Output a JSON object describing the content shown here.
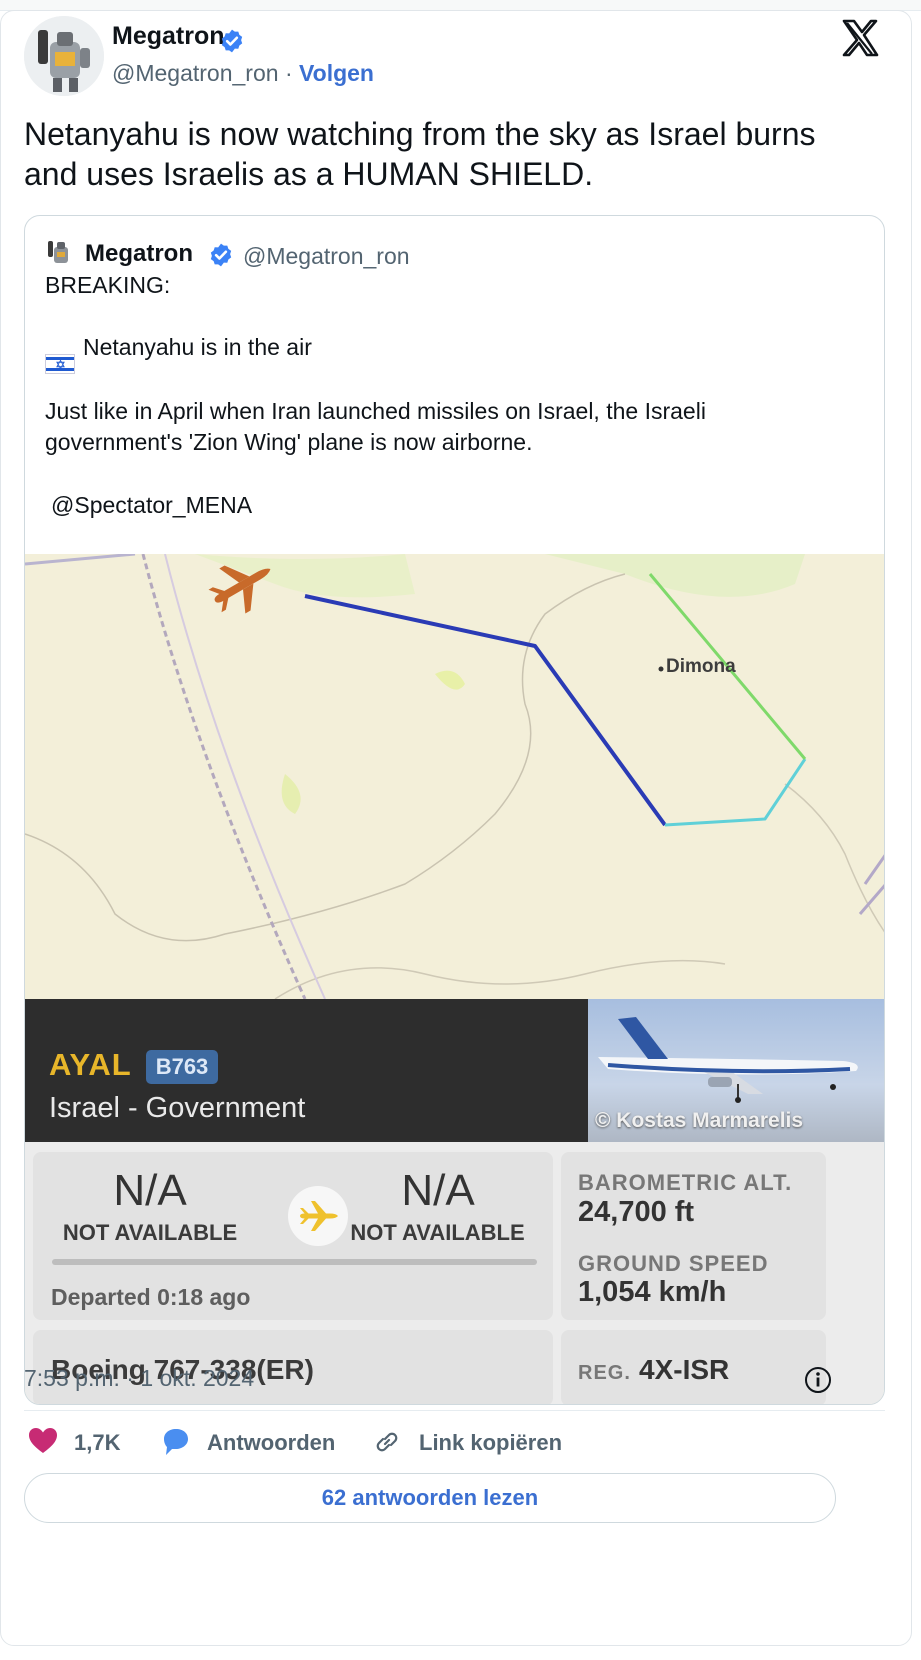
{
  "author": {
    "name": "Megatron",
    "handle": "@Megatron_ron",
    "separator": "·",
    "follow_label": "Volgen"
  },
  "tweet": {
    "text_line1": "Netanyahu is now watching from the sky as Israel burns",
    "text_line2": "and uses Israelis as a HUMAN SHIELD."
  },
  "quoted": {
    "name": "Megatron",
    "handle": "@Megatron_ron",
    "line1": "BREAKING:",
    "line2": "Netanyahu is in the air",
    "line3": "Just like in April when Iran launched missiles on Israel, the Israeli",
    "line4": "government's 'Zion Wing' plane is now airborne.",
    "line5": "@Spectator_MENA"
  },
  "media": {
    "map_label": "Dimona",
    "callsign": "AYAL",
    "type_code": "B763",
    "operator": "Israel - Government",
    "photo_credit": "© Kostas Marmarelis",
    "origin_code": "N/A",
    "origin_sub": "NOT AVAILABLE",
    "dest_code": "N/A",
    "dest_sub": "NOT AVAILABLE",
    "departed": "Departed 0:18 ago",
    "baro_label": "BAROMETRIC ALT.",
    "baro_value": "24,700 ft",
    "speed_label": "GROUND SPEED",
    "speed_value": "1,054 km/h",
    "aircraft": "Boeing 767-338(ER)",
    "reg_label": "REG.",
    "reg_value": "4X-ISR",
    "colors": {
      "track_blue": "#2a3bb5",
      "track_cyan": "#5fd0d8",
      "track_green": "#7fd96a",
      "plane_orange": "#c86a2a"
    }
  },
  "footer": {
    "timestamp": "7:53 p.m. · 1 okt. 2024",
    "likes": "1,7K",
    "reply_label": "Antwoorden",
    "copy_label": "Link kopiëren",
    "read_more": "62 antwoorden lezen"
  },
  "icons": [
    "verified-badge-icon",
    "x-logo-icon",
    "israel-flag-icon",
    "airplane-icon",
    "info-icon",
    "heart-icon",
    "reply-icon",
    "link-icon"
  ]
}
